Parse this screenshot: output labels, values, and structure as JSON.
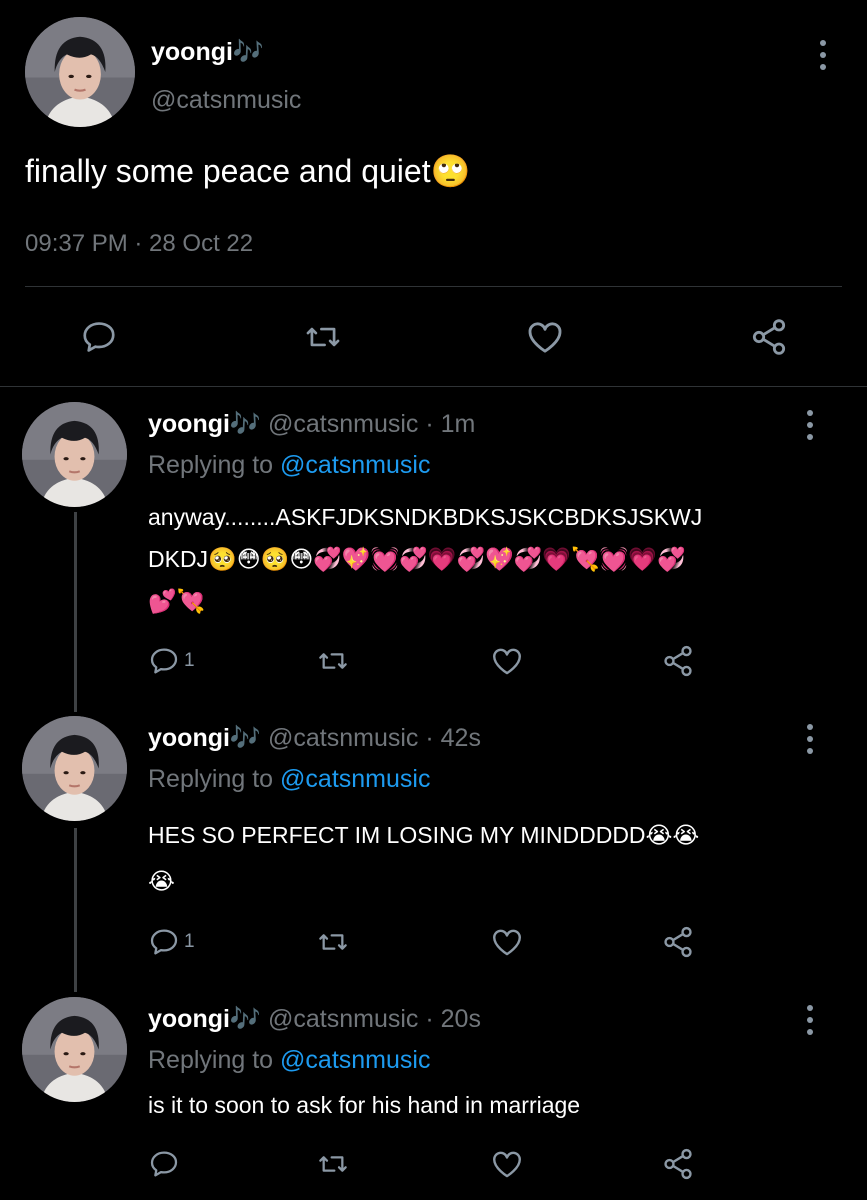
{
  "main_tweet": {
    "display_name": "yoongi🎶",
    "handle": "@catsnmusic",
    "text": "finally some peace and quiet🙄",
    "timestamp": "09:37 PM · 28 Oct 22"
  },
  "replies": [
    {
      "display_name": "yoongi🎶",
      "handle_time": "@catsnmusic · 1m",
      "replying_prefix": "Replying to ",
      "replying_to": "@catsnmusic",
      "text_line1": "anyway........ASKFJDKSNDKBDKSJSKCBDKSJSKWJ",
      "text_line2": "DKDJ🥺😳🥺😳💞💖💓💞💗💞💖💞💗💘💓💗💞",
      "text_line3": "💕💘",
      "reply_count": "1"
    },
    {
      "display_name": "yoongi🎶",
      "handle_time": "@catsnmusic · 42s",
      "replying_prefix": "Replying to ",
      "replying_to": "@catsnmusic",
      "text_line1": "HES SO PERFECT IM LOSING MY MINDDDDD😭😭",
      "text_line2": "😭",
      "reply_count": "1"
    },
    {
      "display_name": "yoongi🎶",
      "handle_time": "@catsnmusic · 20s",
      "replying_prefix": "Replying to ",
      "replying_to": "@catsnmusic",
      "text_line1": "is it to soon to ask for his hand in marriage",
      "reply_count": ""
    }
  ],
  "icons": {
    "reply": "reply-icon",
    "retweet": "retweet-icon",
    "like": "heart-icon",
    "share": "share-icon",
    "more": "more-options-icon"
  },
  "colors": {
    "background": "#000000",
    "text": "#e7e9ea",
    "muted": "#71767b",
    "link": "#1d9bf0",
    "divider": "#2f3336"
  }
}
